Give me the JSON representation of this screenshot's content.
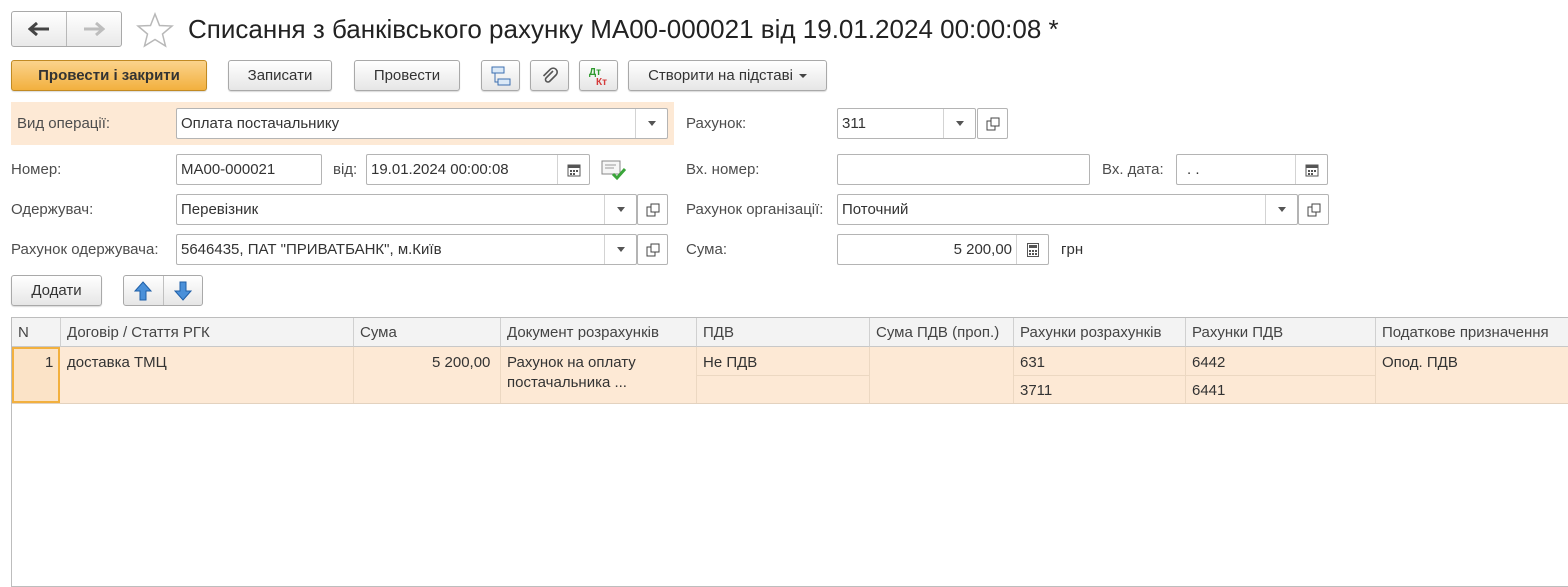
{
  "header": {
    "title": "Списання з банківського рахунку МА00-000021 від 19.01.2024 00:00:08 *"
  },
  "toolbar": {
    "post_close": "Провести і закрити",
    "save": "Записати",
    "post": "Провести",
    "create_based": "Створити на підставі"
  },
  "form": {
    "operation_label": "Вид операції:",
    "operation_value": "Оплата постачальнику",
    "account_label": "Рахунок:",
    "account_value": "311",
    "number_label": "Номер:",
    "number_value": "МА00-000021",
    "from_label": "від:",
    "date_value": "19.01.2024 00:00:08",
    "in_number_label": "Вх. номер:",
    "in_number_value": "",
    "in_date_label": "Вх. дата:",
    "in_date_value": " .  .",
    "recipient_label": "Одержувач:",
    "recipient_value": "Перевізник",
    "org_account_label": "Рахунок організації:",
    "org_account_value": "Поточний",
    "recipient_account_label": "Рахунок одержувача:",
    "recipient_account_value": "5646435, ПАТ \"ПРИВАТБАНК\", м.Київ",
    "sum_label": "Сума:",
    "sum_value": "5 200,00",
    "currency": "грн"
  },
  "table_toolbar": {
    "add": "Додати"
  },
  "table": {
    "columns": [
      "N",
      "Договір / Стаття РГК",
      "Сума",
      "Документ розрахунків",
      "ПДВ",
      "Сума ПДВ (проп.)",
      "Рахунки розрахунків",
      "Рахунки ПДВ",
      "Податкове призначення"
    ],
    "rows": [
      {
        "n": "1",
        "contract": "доставка ТМЦ",
        "sum": "5 200,00",
        "doc_line1": "Рахунок на оплату",
        "doc_line2": "постачальника ...",
        "vat": "Не ПДВ",
        "vat_sum": "",
        "acc1": "631",
        "acc2": "3711",
        "vat_acc1": "6442",
        "vat_acc2": "6441",
        "tax_purpose": "Опод. ПДВ"
      }
    ]
  },
  "colors": {
    "primary_button": "#f2b03e",
    "highlight_row": "#fde9d5"
  }
}
